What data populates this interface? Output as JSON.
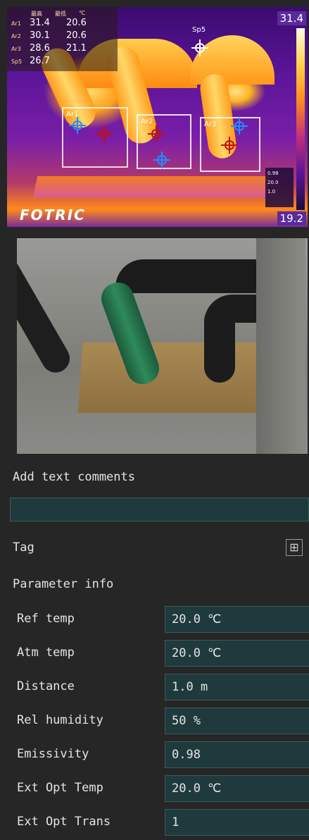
{
  "thermal": {
    "header_col1": "最高",
    "header_col2": "最低",
    "header_unit": "℃",
    "rows": [
      {
        "name": "Ar1",
        "max": "31.4",
        "min": "20.6"
      },
      {
        "name": "Ar2",
        "max": "30.1",
        "min": "20.6"
      },
      {
        "name": "Ar3",
        "max": "28.6",
        "min": "21.1"
      },
      {
        "name": "Sp5",
        "max": "26.7",
        "min": ""
      }
    ],
    "scale_max": "31.4",
    "scale_min": "19.2",
    "param_lines": [
      "0.98",
      "20.0",
      "1.0"
    ],
    "logo": "FOTRIC",
    "area_labels": [
      "Ar1",
      "Ar2",
      "Ar3"
    ],
    "spot_label": "Sp5",
    "palette": [
      "#1c0d3d",
      "#5a1598",
      "#c0307a",
      "#ff8a1b",
      "#ffd34a",
      "#ffffe0"
    ]
  },
  "form": {
    "comments_label": "Add text comments",
    "comments_value": "",
    "tag_label": "Tag",
    "tag_add_icon": "⊞",
    "param_title": "Parameter info",
    "params": [
      {
        "label": "Ref temp",
        "value": "20.0 ℃"
      },
      {
        "label": "Atm temp",
        "value": "20.0 ℃"
      },
      {
        "label": "Distance",
        "value": "1.0 m"
      },
      {
        "label": "Rel humidity",
        "value": "50 %"
      },
      {
        "label": "Emissivity",
        "value": "0.98"
      },
      {
        "label": "Ext Opt Temp",
        "value": "20.0 ℃"
      },
      {
        "label": "Ext Opt Trans",
        "value": "1"
      }
    ]
  }
}
